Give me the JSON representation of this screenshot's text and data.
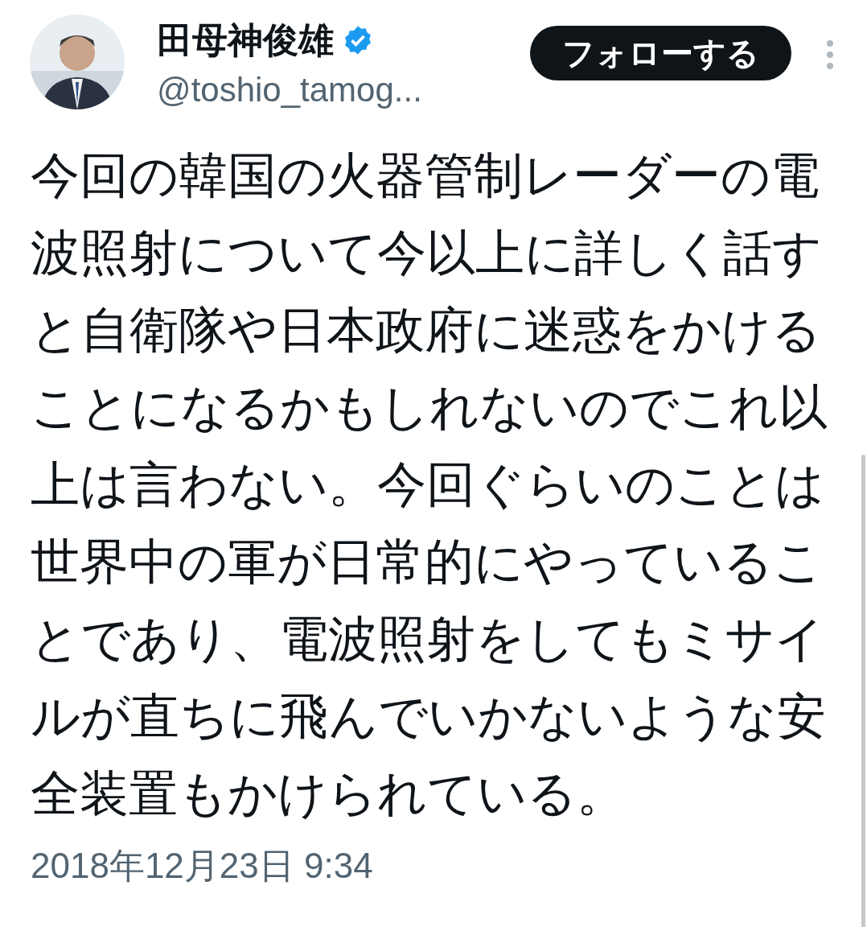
{
  "author": {
    "name": "田母神俊雄",
    "verified": true,
    "handle": "@toshio_tamog..."
  },
  "follow_button": "フォローする",
  "tweet_text": "今回の韓国の火器管制レーダーの電波照射について今以上に詳しく話すと自衛隊や日本政府に迷惑をかけることになるかもしれないのでこれ以上は言わない。今回ぐらいのことは世界中の軍が日常的にやっていることであり、電波照射をしてもミサイルが直ちに飛んでいかないような安全装置もかけられている。",
  "timestamp": "2018年12月23日 9:34"
}
